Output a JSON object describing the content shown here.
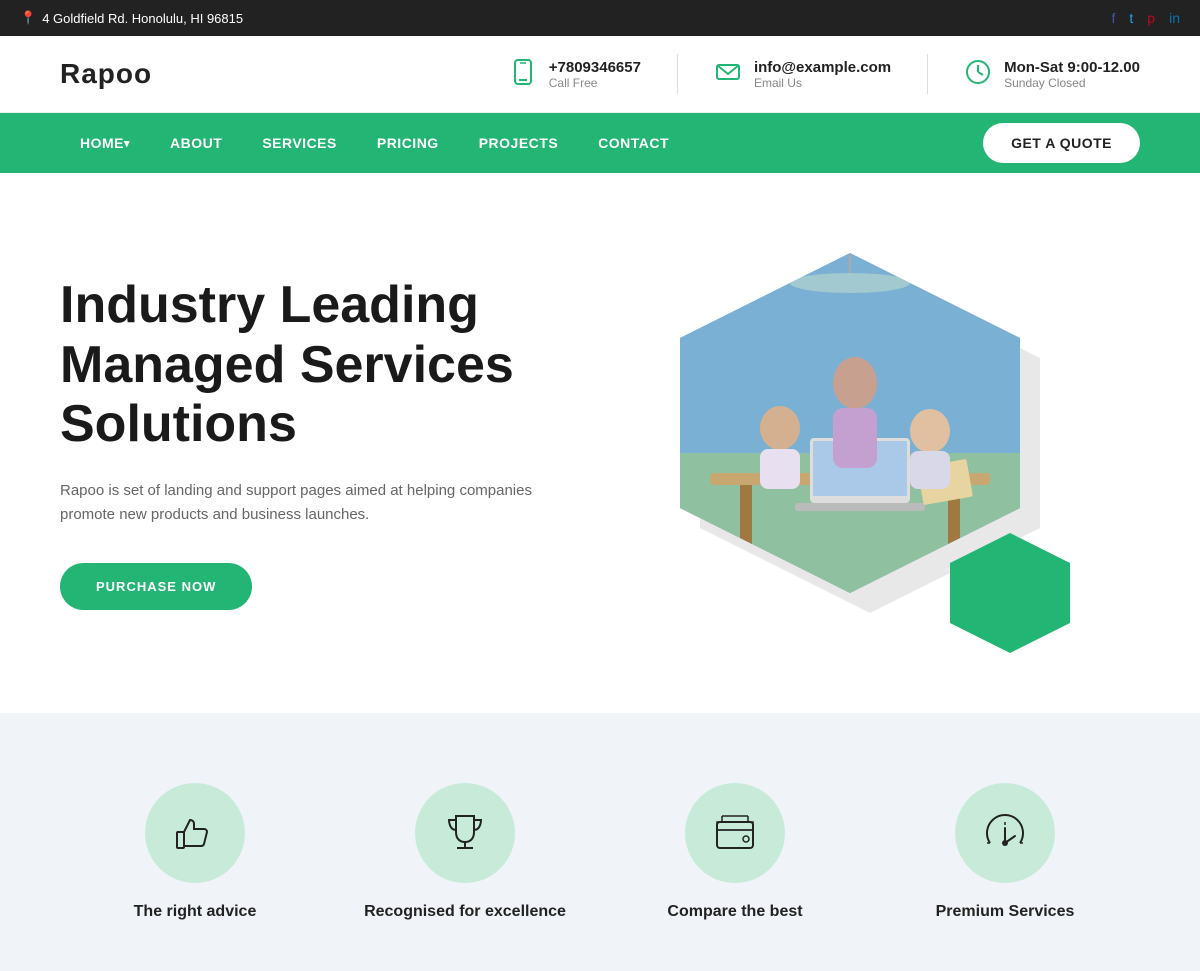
{
  "topbar": {
    "address": "4 Goldfield Rd. Honolulu, HI 96815",
    "socials": [
      "f",
      "t",
      "p",
      "in"
    ]
  },
  "header": {
    "logo": "Rapoo",
    "contacts": [
      {
        "icon": "phone",
        "top": "+7809346657",
        "bottom": "Call Free"
      },
      {
        "icon": "email",
        "top": "info@example.com",
        "bottom": "Email Us"
      },
      {
        "icon": "clock",
        "top": "Mon-Sat 9:00-12.00",
        "bottom": "Sunday Closed"
      }
    ]
  },
  "nav": {
    "items": [
      {
        "label": "HOME",
        "hasArrow": true
      },
      {
        "label": "ABOUT",
        "hasArrow": false
      },
      {
        "label": "SERVICES",
        "hasArrow": false
      },
      {
        "label": "PRICING",
        "hasArrow": false
      },
      {
        "label": "PROJECTS",
        "hasArrow": false
      },
      {
        "label": "CONTACT",
        "hasArrow": false
      }
    ],
    "cta": "GET A QUOTE"
  },
  "hero": {
    "title": "Industry Leading Managed Services Solutions",
    "description": "Rapoo is set of landing and support pages aimed at helping companies promote new products and business launches.",
    "cta": "PURCHASE NOW"
  },
  "features": [
    {
      "label": "The right advice",
      "icon": "thumbs-up"
    },
    {
      "label": "Recognised for excellence",
      "icon": "trophy"
    },
    {
      "label": "Compare the best",
      "icon": "wallet"
    },
    {
      "label": "Premium Services",
      "icon": "gauge"
    }
  ]
}
